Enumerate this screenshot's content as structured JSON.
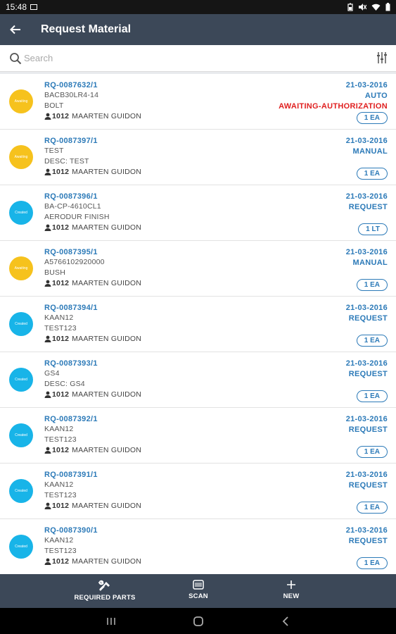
{
  "status_bar": {
    "time": "15:48"
  },
  "app_bar": {
    "title": "Request Material"
  },
  "search": {
    "placeholder": "Search"
  },
  "requests": [
    {
      "code": "RQ-0087632/1",
      "line1": "BACB30LR4-14",
      "line2": "BOLT",
      "user_id": "1012",
      "user_name": "MAARTEN GUIDON",
      "date": "21-03-2016",
      "type": "AUTO",
      "status_text": "AWAITING-AUTHORIZATION",
      "qty": "1 EA",
      "badge": "Awaiting",
      "badge_kind": "awaiting"
    },
    {
      "code": "RQ-0087397/1",
      "line1": "TEST",
      "line2": "DESC: TEST",
      "user_id": "1012",
      "user_name": "MAARTEN GUIDON",
      "date": "21-03-2016",
      "type": "MANUAL",
      "status_text": "",
      "qty": "1 EA",
      "badge": "Awaiting",
      "badge_kind": "awaiting"
    },
    {
      "code": "RQ-0087396/1",
      "line1": "BA-CP-4610CL1",
      "line2": "AERODUR FINISH",
      "user_id": "1012",
      "user_name": "MAARTEN GUIDON",
      "date": "21-03-2016",
      "type": "REQUEST",
      "status_text": "",
      "qty": "1 LT",
      "badge": "Created",
      "badge_kind": "created"
    },
    {
      "code": "RQ-0087395/1",
      "line1": "A5766102920000",
      "line2": "BUSH",
      "user_id": "1012",
      "user_name": "MAARTEN GUIDON",
      "date": "21-03-2016",
      "type": "MANUAL",
      "status_text": "",
      "qty": "1 EA",
      "badge": "Awaiting",
      "badge_kind": "awaiting"
    },
    {
      "code": "RQ-0087394/1",
      "line1": "KAAN12",
      "line2": "TEST123",
      "user_id": "1012",
      "user_name": "MAARTEN GUIDON",
      "date": "21-03-2016",
      "type": "REQUEST",
      "status_text": "",
      "qty": "1 EA",
      "badge": "Created",
      "badge_kind": "created"
    },
    {
      "code": "RQ-0087393/1",
      "line1": "GS4",
      "line2": "DESC: GS4",
      "user_id": "1012",
      "user_name": "MAARTEN GUIDON",
      "date": "21-03-2016",
      "type": "REQUEST",
      "status_text": "",
      "qty": "1 EA",
      "badge": "Created",
      "badge_kind": "created"
    },
    {
      "code": "RQ-0087392/1",
      "line1": "KAAN12",
      "line2": "TEST123",
      "user_id": "1012",
      "user_name": "MAARTEN GUIDON",
      "date": "21-03-2016",
      "type": "REQUEST",
      "status_text": "",
      "qty": "1 EA",
      "badge": "Created",
      "badge_kind": "created"
    },
    {
      "code": "RQ-0087391/1",
      "line1": "KAAN12",
      "line2": "TEST123",
      "user_id": "1012",
      "user_name": "MAARTEN GUIDON",
      "date": "21-03-2016",
      "type": "REQUEST",
      "status_text": "",
      "qty": "1 EA",
      "badge": "Created",
      "badge_kind": "created"
    },
    {
      "code": "RQ-0087390/1",
      "line1": "KAAN12",
      "line2": "TEST123",
      "user_id": "1012",
      "user_name": "MAARTEN GUIDON",
      "date": "21-03-2016",
      "type": "REQUEST",
      "status_text": "",
      "qty": "1 EA",
      "badge": "Created",
      "badge_kind": "created"
    }
  ],
  "bottom_bar": {
    "required_parts": "REQUIRED PARTS",
    "scan": "SCAN",
    "new": "NEW"
  },
  "colors": {
    "header": "#3c4858",
    "link_blue": "#2c7ab8",
    "alert_red": "#e02020",
    "awaiting_badge": "#f6c21d",
    "created_badge": "#18b4e8"
  },
  "icons": {
    "back": "arrow-left-icon",
    "search": "search-icon",
    "filter": "sliders-icon",
    "user": "person-icon",
    "required_parts": "tools-icon",
    "scan": "barcode-icon",
    "new": "plus-icon"
  }
}
